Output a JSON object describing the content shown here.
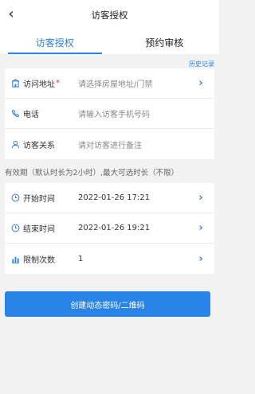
{
  "header": {
    "title": "访客授权",
    "back_icon": "chevron-left-icon"
  },
  "tabs": [
    {
      "label": "访客授权",
      "active": true
    },
    {
      "label": "预约审核",
      "active": false
    }
  ],
  "history_link": "历史记录",
  "visitor_form": {
    "address": {
      "label": "访问地址",
      "required_mark": "*",
      "placeholder": "请选择房屋地址/门禁",
      "icon": "building-icon"
    },
    "phone": {
      "label": "电话",
      "placeholder": "请输入访客手机号码",
      "icon": "phone-icon"
    },
    "relation": {
      "label": "访客关系",
      "placeholder": "请对访客进行备注",
      "icon": "person-icon"
    }
  },
  "notice": "有效期（默认时长为2小时）,最大可选时长（不限）",
  "time_form": {
    "start": {
      "label": "开始时间",
      "value": "2022-01-26 17:21",
      "icon": "clock-icon"
    },
    "end": {
      "label": "结束时间",
      "value": "2022-01-26 19:21",
      "icon": "clock-icon"
    },
    "limit": {
      "label": "限制次数",
      "value": "1",
      "icon": "bar-chart-icon"
    }
  },
  "create_button": "创建动态密码/二维码",
  "colors": {
    "accent": "#2a84e8",
    "required": "#e33333",
    "background": "#f2f2f2"
  }
}
